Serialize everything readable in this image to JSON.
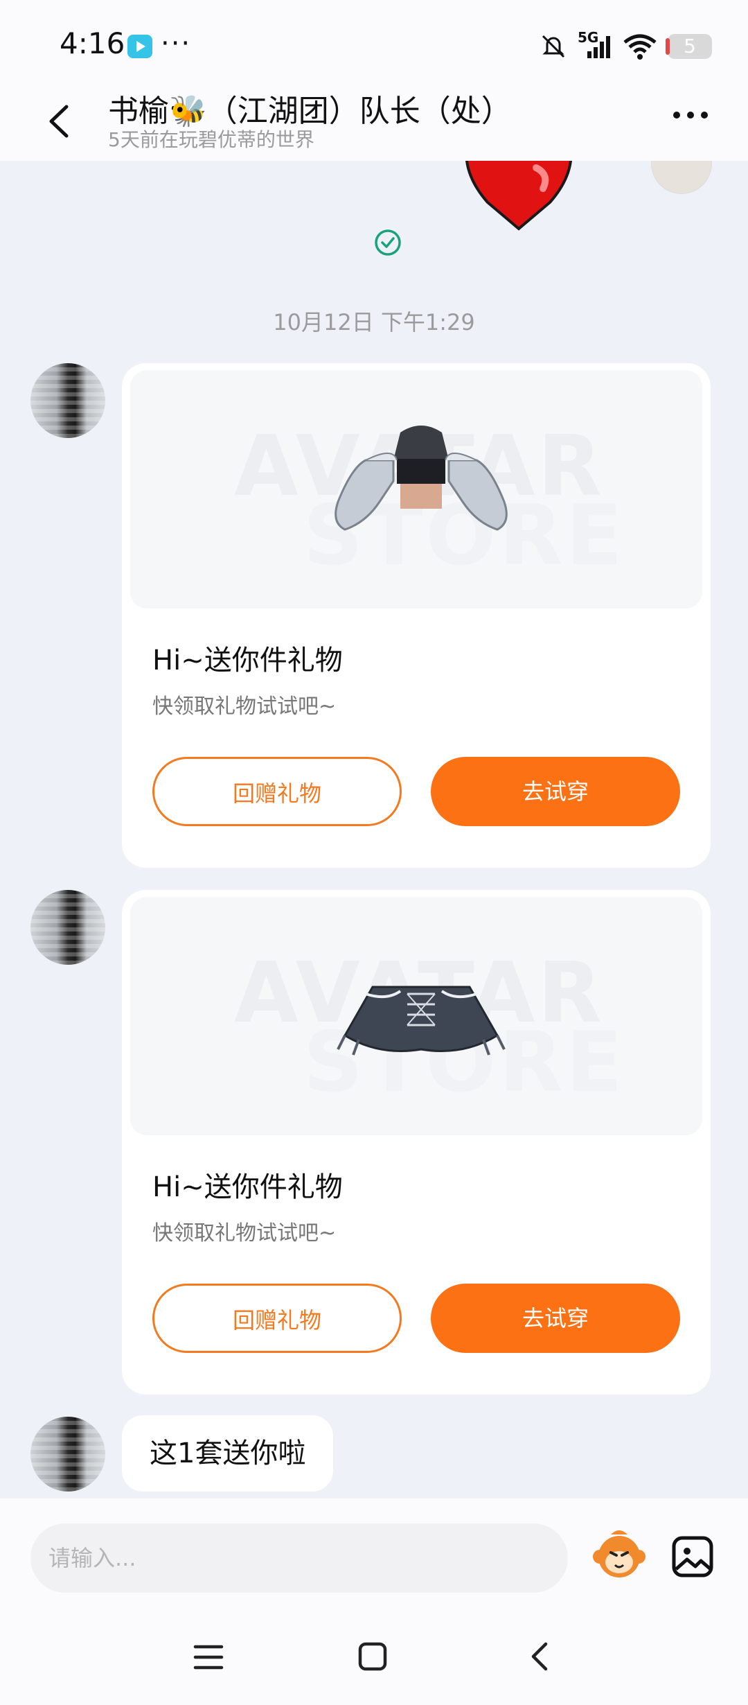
{
  "status_bar": {
    "time": "4:16",
    "more_indicator": "···",
    "network": "5G",
    "battery": "5"
  },
  "header": {
    "title": "书榆🐝（江湖团）队长（处）",
    "subtitle": "5天前在玩碧优蒂的世界"
  },
  "chat": {
    "timestamp": "10月12日 下午1:29",
    "gift_cards": [
      {
        "watermark_line1": "AVATAR",
        "watermark_line2": "STORE",
        "title": "Hi~送你件礼物",
        "subtitle": "快领取礼物试试吧~",
        "return_gift_label": "回赠礼物",
        "try_on_label": "去试穿"
      },
      {
        "watermark_line1": "AVATAR",
        "watermark_line2": "STORE",
        "title": "Hi~送你件礼物",
        "subtitle": "快领取礼物试试吧~",
        "return_gift_label": "回赠礼物",
        "try_on_label": "去试穿"
      }
    ],
    "text_message": "这1套送你啦"
  },
  "input_bar": {
    "placeholder": "请输入..."
  },
  "colors": {
    "accent_orange": "#fc7113",
    "background": "#eef1f7",
    "check_green": "#1aa37a"
  }
}
